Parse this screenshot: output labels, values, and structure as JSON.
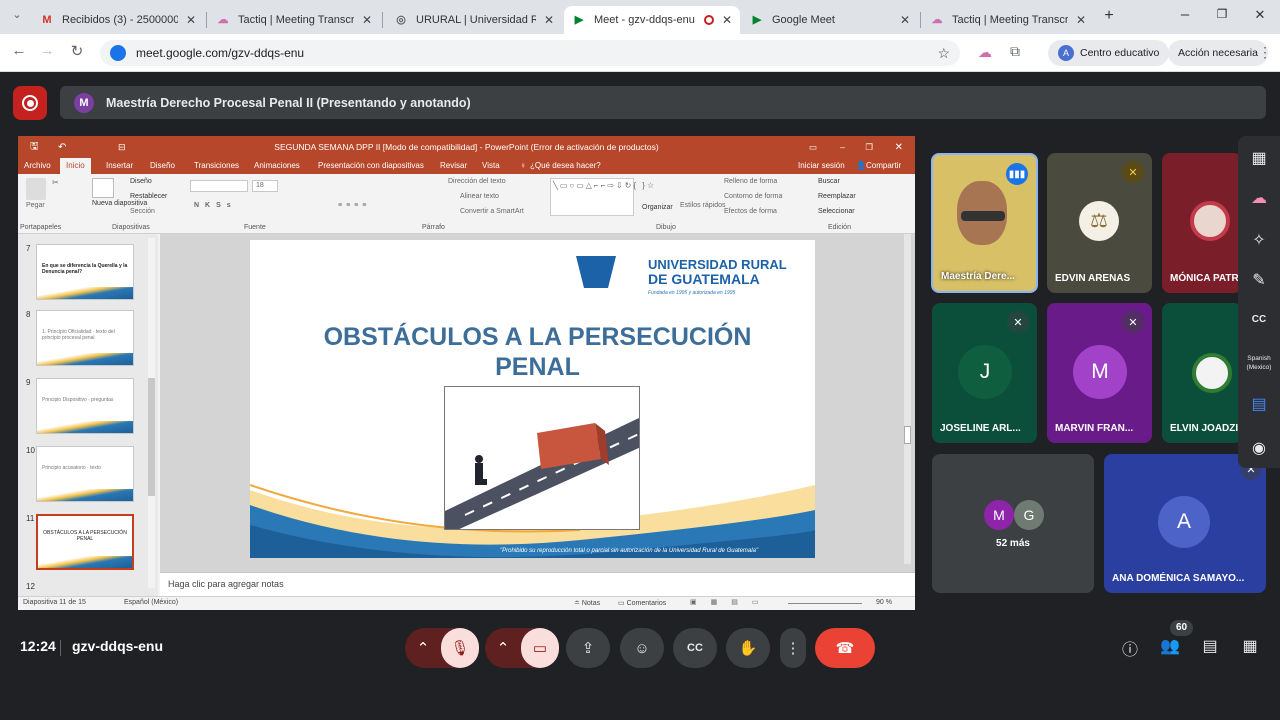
{
  "browser": {
    "tabs": [
      {
        "label": "Recibidos (3) - 2500000626",
        "icon": "gmail-icon"
      },
      {
        "label": "Tactiq | Meeting Transcript",
        "icon": "tactiq-icon"
      },
      {
        "label": "URURAL | Universidad Rural",
        "icon": "globe-icon"
      },
      {
        "label": "Meet - gzv-ddqs-enu",
        "icon": "meet-icon",
        "active": true
      },
      {
        "label": "Google Meet",
        "icon": "meet-icon"
      },
      {
        "label": "Tactiq | Meeting Transcript",
        "icon": "tactiq-icon"
      }
    ],
    "url": "meet.google.com/gzv-ddqs-enu",
    "profile_label": "Centro educativo",
    "profile_initial": "A",
    "action_label": "Acción necesaria"
  },
  "meeting": {
    "presenter_initial": "M",
    "presenter_banner": "Maestría Derecho Procesal Penal II (Presentando y anotando)",
    "time": "12:24",
    "code": "gzv-ddqs-enu",
    "people_count": "60"
  },
  "ppt": {
    "title": "SEGUNDA SEMANA DPP II [Modo de compatibilidad] - PowerPoint (Error de activación de productos)",
    "tabs": [
      "Archivo",
      "Inicio",
      "Insertar",
      "Diseño",
      "Transiciones",
      "Animaciones",
      "Presentación con diapositivas",
      "Revisar",
      "Vista",
      "¿Qué desea hacer?"
    ],
    "signin": "Iniciar sesión",
    "share": "Compartir",
    "groups": {
      "clipboard": "Portapapeles",
      "slides": "Diapositivas",
      "font": "Fuente",
      "paragraph": "Párrafo",
      "drawing": "Dibujo",
      "editing": "Edición"
    },
    "buttons": {
      "paste": "Pegar",
      "new_slide": "Nueva diapositiva",
      "layout": "Diseño",
      "reset": "Restablecer",
      "section": "Sección",
      "text_direction": "Dirección del texto",
      "align_text": "Alinear texto",
      "smartart": "Convertir a SmartArt",
      "arrange": "Organizar",
      "quick_styles": "Estilos rápidos",
      "fill": "Relleno de forma",
      "outline": "Contorno de forma",
      "effects": "Efectos de forma",
      "find": "Buscar",
      "replace": "Reemplazar",
      "select": "Seleccionar",
      "font_size": "18"
    },
    "thumbs": [
      {
        "num": "7",
        "text": "En que se diferencia la Querella y la Denuncia penal?"
      },
      {
        "num": "8",
        "text": "1. Principio Oficialidad · texto del principio procesal penal"
      },
      {
        "num": "9",
        "text": "Principio Dispositivo · preguntas"
      },
      {
        "num": "10",
        "text": "Principio acusatorio · texto"
      },
      {
        "num": "11",
        "text": "OBSTÁCULOS A LA PERSECUCIÓN PENAL"
      },
      {
        "num": "12",
        "text": ""
      }
    ],
    "slide": {
      "university_line1": "UNIVERSIDAD RURAL",
      "university_line2": "DE GUATEMALA",
      "university_tagline": "Fundada en 1995 y autorizada en 1995",
      "title": "OBSTÁCULOS A LA PERSECUCIÓN PENAL",
      "footer": "\"Prohibido su reproducción total o parcial sin autorización de la Universidad Rural de Guatemala\""
    },
    "notes_placeholder": "Haga clic para agregar notas",
    "status": {
      "slide": "Diapositiva 11 de 15",
      "lang": "Español (México)",
      "notes": "Notas",
      "comments": "Comentarios",
      "zoom": "90 %"
    }
  },
  "participants": [
    {
      "name": "Maestría Dere...",
      "type": "video"
    },
    {
      "name": "EDVIN ARENAS",
      "type": "photo",
      "muted": true
    },
    {
      "name": "MÓNICA PATRI...",
      "type": "photo"
    },
    {
      "name": "JOSELINE ARL...",
      "initial": "J",
      "muted": true
    },
    {
      "name": "MARVIN FRAN...",
      "initial": "M",
      "muted": true
    },
    {
      "name": "ELVIN JOADZI...",
      "type": "photo"
    },
    {
      "name": "ANA DOMÉNICA SAMAYO...",
      "initial": "A",
      "muted": true
    }
  ],
  "others": {
    "initials": [
      "M",
      "G"
    ],
    "label": "52 más"
  },
  "side": {
    "caption_lang": "Spanish (Mexico)"
  },
  "colors": {
    "ppt": "#b7472a",
    "hangup": "#ea4335",
    "muted_btn": "#f9dedc",
    "meet_bg": "#202124"
  }
}
